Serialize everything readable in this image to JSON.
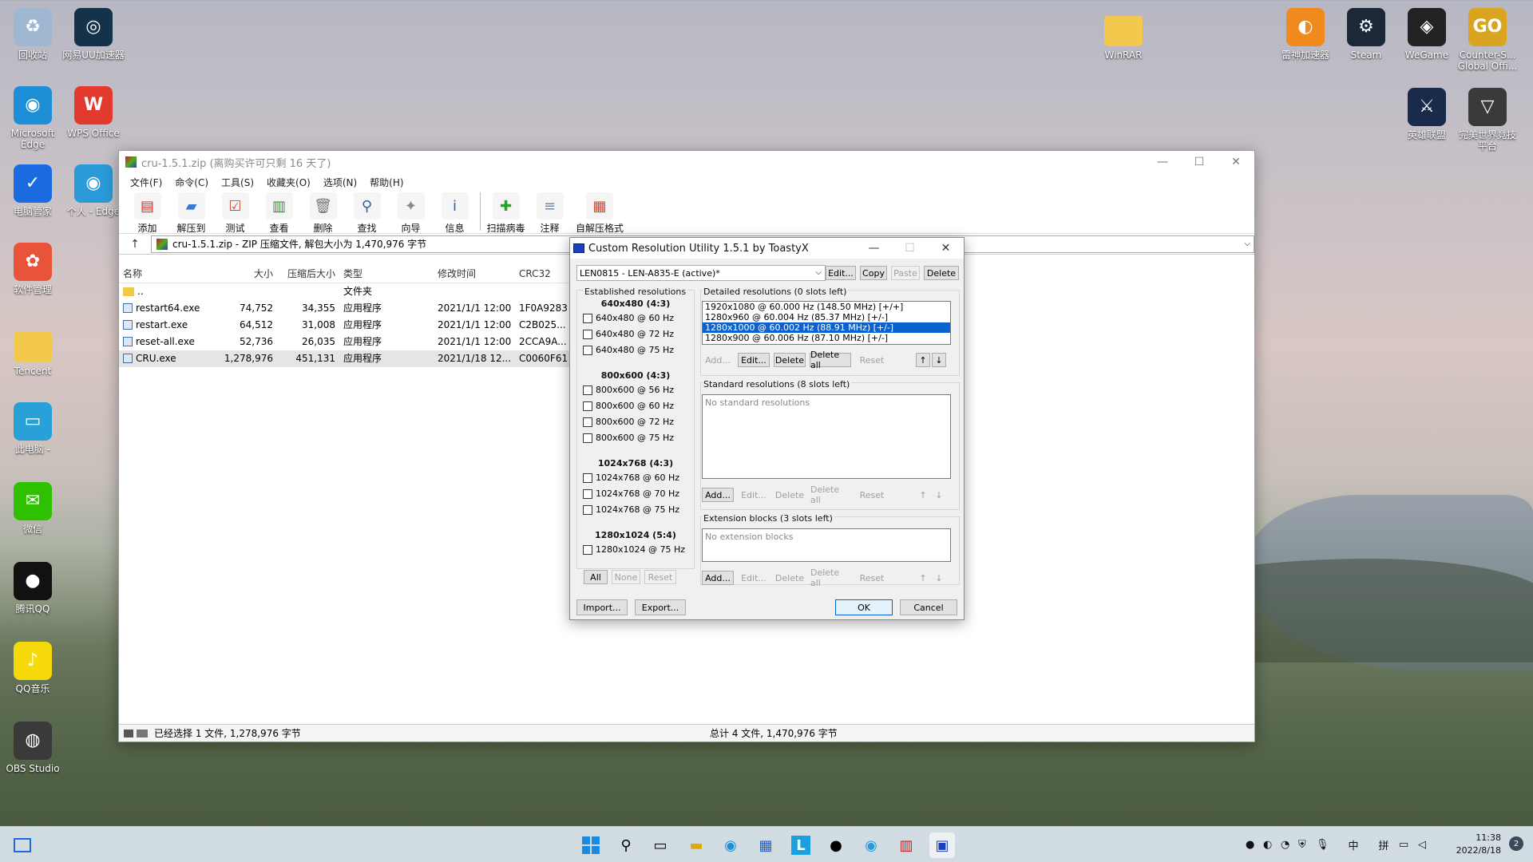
{
  "desktop": {
    "left_icons": [
      {
        "label": "回收站",
        "icon": "recycle-bin-icon",
        "color": "#9fb7d0"
      },
      {
        "label": "网易UU加速器",
        "icon": "uu-booster-icon",
        "color": "#14324a"
      },
      {
        "label": "Microsoft Edge",
        "icon": "edge-icon",
        "color": "#1d8fd6"
      },
      {
        "label": "WPS Office",
        "icon": "wps-icon",
        "color": "#e23a2e"
      },
      {
        "label": "电脑管家",
        "icon": "pc-manager-icon",
        "color": "#1a6be0"
      },
      {
        "label": "个人 - Edge",
        "icon": "edge-profile-icon",
        "color": "#2a9ad8"
      },
      {
        "label": "软件管理",
        "icon": "software-manager-icon",
        "color": "#e8533a"
      },
      {
        "label": "Tencent",
        "icon": "folder-icon",
        "color": "#f2c94c"
      },
      {
        "label": "此电脑 -",
        "icon": "this-pc-icon",
        "color": "#2aa0d8"
      },
      {
        "label": "微信",
        "icon": "wechat-icon",
        "color": "#2dc100"
      },
      {
        "label": "腾讯QQ",
        "icon": "qq-icon",
        "color": "#111111"
      },
      {
        "label": "QQ音乐",
        "icon": "qq-music-icon",
        "color": "#f5d90a"
      },
      {
        "label": "OBS Studio",
        "icon": "obs-icon",
        "color": "#3a3a3a"
      }
    ],
    "right_icons": [
      {
        "label": "WinRAR",
        "icon": "folder-icon",
        "color": "#f2c94c"
      },
      {
        "label": "雷神加速器",
        "icon": "leishen-icon",
        "color": "#f08a1c"
      },
      {
        "label": "Steam",
        "icon": "steam-icon",
        "color": "#1b2838"
      },
      {
        "label": "WeGame",
        "icon": "wegame-icon",
        "color": "#222222"
      },
      {
        "label": "Counter-S... Global Offi...",
        "icon": "csgo-icon",
        "color": "#d9a520"
      },
      {
        "label": "英雄联盟",
        "icon": "lol-icon",
        "color": "#1a2a4a"
      },
      {
        "label": "完美世界竞技平台",
        "icon": "perfect-world-icon",
        "color": "#3a3a3a"
      }
    ]
  },
  "winrar": {
    "title": "cru-1.5.1.zip (离购买许可只剩 16 天了)",
    "menu": [
      "文件(F)",
      "命令(C)",
      "工具(S)",
      "收藏夹(O)",
      "选项(N)",
      "帮助(H)"
    ],
    "toolbar": [
      {
        "label": "添加",
        "icon": "add-archive-icon",
        "color": "#c9302c"
      },
      {
        "label": "解压到",
        "icon": "extract-to-icon",
        "color": "#3a7ad0"
      },
      {
        "label": "测试",
        "icon": "test-icon",
        "color": "#c94a3a"
      },
      {
        "label": "查看",
        "icon": "view-icon",
        "color": "#3a8a3a"
      },
      {
        "label": "删除",
        "icon": "delete-icon",
        "color": "#777777"
      },
      {
        "label": "查找",
        "icon": "find-icon",
        "color": "#2a5fb5"
      },
      {
        "label": "向导",
        "icon": "wizard-icon",
        "color": "#888888"
      },
      {
        "label": "信息",
        "icon": "info-icon",
        "color": "#2a5fb5"
      },
      {
        "label": "扫描病毒",
        "icon": "scan-virus-icon",
        "color": "#2aa02a"
      },
      {
        "label": "注释",
        "icon": "comment-icon",
        "color": "#6a8aaa"
      },
      {
        "label": "自解压格式",
        "icon": "sfx-icon",
        "color": "#c94a3a"
      }
    ],
    "address": "cru-1.5.1.zip - ZIP 压缩文件, 解包大小为 1,470,976 字节",
    "columns": [
      "名称",
      "大小",
      "压缩后大小",
      "类型",
      "修改时间",
      "CRC32"
    ],
    "files": [
      {
        "name": "..",
        "size": "",
        "packed": "",
        "type": "文件夹",
        "modified": "",
        "crc": "",
        "folder": true
      },
      {
        "name": "restart64.exe",
        "size": "74,752",
        "packed": "34,355",
        "type": "应用程序",
        "modified": "2021/1/1 12:00",
        "crc": "1F0A9283"
      },
      {
        "name": "restart.exe",
        "size": "64,512",
        "packed": "31,008",
        "type": "应用程序",
        "modified": "2021/1/1 12:00",
        "crc": "C2B025..."
      },
      {
        "name": "reset-all.exe",
        "size": "52,736",
        "packed": "26,035",
        "type": "应用程序",
        "modified": "2021/1/1 12:00",
        "crc": "2CCA9A..."
      },
      {
        "name": "CRU.exe",
        "size": "1,278,976",
        "packed": "451,131",
        "type": "应用程序",
        "modified": "2021/1/18 12...",
        "crc": "C0060F61",
        "selected": true
      }
    ],
    "status_left": "已经选择 1 文件, 1,278,976 字节",
    "status_right": "总计 4 文件, 1,470,976 字节"
  },
  "cru": {
    "title": "Custom Resolution Utility 1.5.1 by ToastyX",
    "monitor": "LEN0815 - LEN-A835-E (active)*",
    "top_buttons": [
      "Edit...",
      "Copy",
      "Paste",
      "Delete"
    ],
    "established_title": "Established resolutions",
    "est_groups": [
      {
        "header": "640x480 (4:3)",
        "items": [
          "640x480 @ 60 Hz",
          "640x480 @ 72 Hz",
          "640x480 @ 75 Hz"
        ]
      },
      {
        "header": "800x600 (4:3)",
        "items": [
          "800x600 @ 56 Hz",
          "800x600 @ 60 Hz",
          "800x600 @ 72 Hz",
          "800x600 @ 75 Hz"
        ]
      },
      {
        "header": "1024x768 (4:3)",
        "items": [
          "1024x768 @ 60 Hz",
          "1024x768 @ 70 Hz",
          "1024x768 @ 75 Hz"
        ]
      },
      {
        "header": "1280x1024 (5:4)",
        "items": [
          "1280x1024 @ 75 Hz"
        ]
      }
    ],
    "est_buttons": [
      "All",
      "None",
      "Reset"
    ],
    "detailed_title": "Detailed resolutions (0 slots left)",
    "detailed_items": [
      "1920x1080 @ 60.000 Hz (148.50 MHz) [+/+]",
      "1280x960 @ 60.004 Hz (85.37 MHz) [+/-]",
      "1280x1000 @ 60.002 Hz (88.91 MHz) [+/-]",
      "1280x900 @ 60.006 Hz (87.10 MHz) [+/-]"
    ],
    "detailed_selected": 2,
    "row_buttons": [
      "Add...",
      "Edit...",
      "Delete",
      "Delete all",
      "Reset"
    ],
    "standard_title": "Standard resolutions (8 slots left)",
    "standard_empty": "No standard resolutions",
    "extension_title": "Extension blocks (3 slots left)",
    "extension_empty": "No extension blocks",
    "import": "Import...",
    "export": "Export...",
    "ok": "OK",
    "cancel": "Cancel"
  },
  "taskbar": {
    "clock_time": "11:38",
    "clock_date": "2022/8/18",
    "ime": "中",
    "layout": "拼",
    "notifications": "2"
  }
}
